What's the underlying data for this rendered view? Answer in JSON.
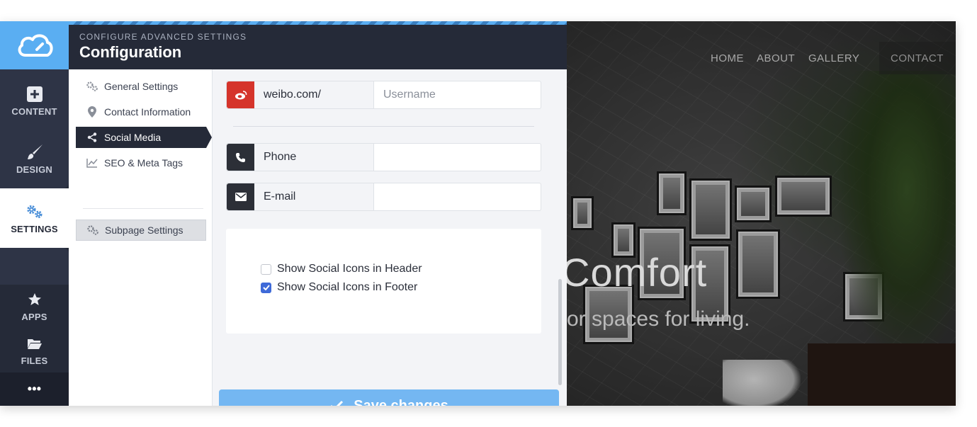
{
  "rail": {
    "items": [
      {
        "label": "CONTENT",
        "icon": "plus-square-icon"
      },
      {
        "label": "DESIGN",
        "icon": "brush-icon"
      },
      {
        "label": "SETTINGS",
        "icon": "gears-icon"
      },
      {
        "label": "APPS",
        "icon": "star-icon"
      },
      {
        "label": "FILES",
        "icon": "folder-icon"
      }
    ],
    "more": "•••"
  },
  "header": {
    "subtitle": "CONFIGURE ADVANCED SETTINGS",
    "title": "Configuration"
  },
  "subnav": {
    "items": [
      {
        "label": "General Settings",
        "icon": "gears-icon"
      },
      {
        "label": "Contact Information",
        "icon": "map-pin-icon"
      },
      {
        "label": "Social Media",
        "icon": "share-icon",
        "active": true
      },
      {
        "label": "SEO & Meta Tags",
        "icon": "line-chart-icon"
      }
    ],
    "subpage": {
      "label": "Subpage Settings",
      "icon": "gears-icon"
    }
  },
  "fields": [
    {
      "label": "weibo.com/",
      "value": "",
      "placeholder": "Username",
      "icon": "weibo-icon",
      "color": "#d5342b"
    },
    {
      "label": "Phone",
      "value": "",
      "placeholder": "",
      "icon": "phone-icon",
      "color": "#2c2f37"
    },
    {
      "label": "E-mail",
      "value": "",
      "placeholder": "",
      "icon": "envelope-icon",
      "color": "#2c2f37"
    }
  ],
  "options": {
    "header_icons": {
      "label": "Show Social Icons in Header",
      "checked": false
    },
    "footer_icons": {
      "label": "Show Social Icons in Footer",
      "checked": true
    }
  },
  "save_button": {
    "label": "Save changes",
    "icon": "check-icon"
  },
  "preview": {
    "nav": [
      "HOME",
      "ABOUT",
      "GALLERY",
      "CONTACT"
    ],
    "hero_title": "Comfort",
    "hero_subtitle": "or spaces for living."
  },
  "colors": {
    "accent": "#5aaef2",
    "rail_dark": "#252a38",
    "save": "#74b7f2",
    "checkbox": "#3f6ad8",
    "weibo": "#d5342b"
  }
}
